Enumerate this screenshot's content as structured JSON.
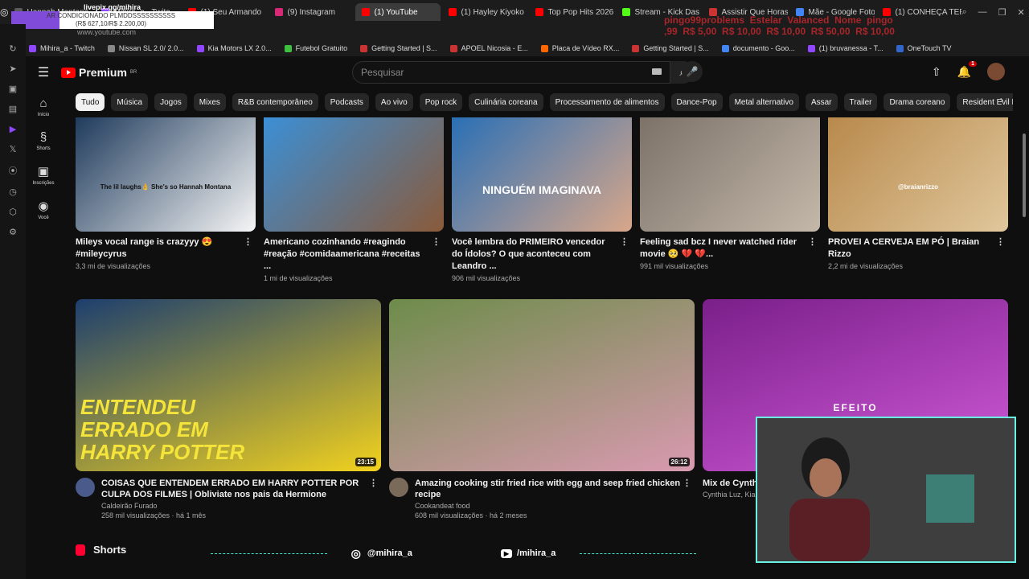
{
  "browser": {
    "tabs": [
      {
        "label": "Hannah Montana",
        "color": "#5a5a5a"
      },
      {
        "label": "Mihira_a - Twitc",
        "color": "#9146ff"
      },
      {
        "label": "(1) Seu Armando",
        "color": "#ff0000"
      },
      {
        "label": "(9) Instagram",
        "color": "#d62976"
      },
      {
        "label": "(1) YouTube",
        "color": "#ff0000",
        "active": true
      },
      {
        "label": "(1) Hayley Kiyoko",
        "color": "#ff0000"
      },
      {
        "label": "Top Pop Hits 2026",
        "color": "#ff0000"
      },
      {
        "label": "Stream - Kick Das",
        "color": "#53fc18"
      },
      {
        "label": "Assistir Que Horas",
        "color": "#cc3333"
      },
      {
        "label": "Mãe - Google Foto",
        "color": "#4285f4"
      },
      {
        "label": "(1) CONHEÇA TER",
        "color": "#ff0000"
      }
    ],
    "window_controls": [
      "search-icon",
      "minimize-icon",
      "restore-icon",
      "close-icon"
    ],
    "address": "www.youtube.com",
    "overlay": {
      "title": "livepix.gg/mihira",
      "line1": "AR CONDICIONADO PLMDDSSSSSSSSSS",
      "line2": "(R$ 627,10/R$ 2.200,00)"
    },
    "prices": "pingo99problems  Estelar  Valanced  Nome  pingo\n,99  R$ 5,00  R$ 10,00  R$ 10,00  R$ 50,00  R$ 10,00",
    "bookmarks": [
      {
        "label": "Mihira_a - Twitch",
        "color": "#9146ff"
      },
      {
        "label": "Nissan SL 2.0/ 2.0...",
        "color": "#888"
      },
      {
        "label": "Kia Motors LX 2.0...",
        "color": "#9146ff"
      },
      {
        "label": "Futebol Gratuito",
        "color": "#3fbf3f"
      },
      {
        "label": "Getting Started | S...",
        "color": "#c33"
      },
      {
        "label": "APOEL Nicosia - E...",
        "color": "#c33"
      },
      {
        "label": "Placa de Vídeo RX...",
        "color": "#f60"
      },
      {
        "label": "Getting Started | S...",
        "color": "#c33"
      },
      {
        "label": "documento - Goo...",
        "color": "#4285f4"
      },
      {
        "label": "(1) bruvanessa - T...",
        "color": "#9146ff"
      },
      {
        "label": "OneTouch TV",
        "color": "#3366cc"
      }
    ]
  },
  "youtube": {
    "logo": "Premium",
    "region": "BR",
    "search_placeholder": "Pesquisar",
    "notifications": "1",
    "guide": [
      {
        "label": "Início",
        "icon": "home-icon"
      },
      {
        "label": "Shorts",
        "icon": "shorts-icon"
      },
      {
        "label": "Inscrições",
        "icon": "subscriptions-icon"
      },
      {
        "label": "Você",
        "icon": "profile-icon"
      }
    ],
    "chips": [
      "Tudo",
      "Música",
      "Jogos",
      "Mixes",
      "R&B contemporâneo",
      "Podcasts",
      "Ao vivo",
      "Pop rock",
      "Culinária coreana",
      "Processamento de alimentos",
      "Dance-Pop",
      "Metal alternativo",
      "Assar",
      "Trailer",
      "Drama coreano",
      "Resident Evil F"
    ],
    "row1": [
      {
        "title": "Mileys vocal range is crazyyy 😍 #mileycyrus",
        "views": "3,3 mi de visualizações",
        "colors": [
          "#1f3b5c",
          "#f6f6f6"
        ],
        "caption": "The lil laughs👌 She's so Hannah Montana"
      },
      {
        "title": "Americano cozinhando #reagindo #reação #comidaamericana #receitas ...",
        "views": "1 mi de visualizações",
        "colors": [
          "#3b8fd6",
          "#8a5a3a"
        ]
      },
      {
        "title": "Você lembra do PRIMEIRO vencedor do Ídolos? O que aconteceu com Leandro ...",
        "views": "906 mil visualizações",
        "colors": [
          "#2a6fb5",
          "#d9a78a"
        ],
        "caption": "NINGUÉM IMAGINAVA"
      },
      {
        "title": "Feeling sad bcz I never watched rider movie 🥺 💔 💔...",
        "views": "991 mil visualizações",
        "colors": [
          "#7c7268",
          "#c4b8aa"
        ]
      },
      {
        "title": "PROVEI A CERVEJA EM PÓ | Braian Rizzo",
        "views": "2,2 mi de visualizações",
        "colors": [
          "#b8894c",
          "#e0c79c"
        ],
        "caption": "@braianrizzo"
      }
    ],
    "row2": [
      {
        "title": "COISAS QUE ENTENDEM ERRADO EM HARRY POTTER POR CULPA DOS FILMES | Obliviate nos pais da Hermione",
        "channel": "Caldeirão Furado",
        "meta": "258 mil visualizações · há 1 mês",
        "duration": "23:15",
        "colors": [
          "#1d3f6e",
          "#f2d21e"
        ],
        "caption": "ENTENDEU ERRADO EM HARRY POTTER",
        "avatar": "#4a5a8a"
      },
      {
        "title": "Amazing cooking stir fried rice with egg and seep fried chicken recipe",
        "channel": "Cookandeat food",
        "meta": "608 mil visualizações · há 2 meses",
        "duration": "26:12",
        "colors": [
          "#6d8c4a",
          "#d99ab0"
        ],
        "avatar": "#7a6a5a"
      },
      {
        "title": "Mix de Cynthi",
        "channel": "Cynthia Luz, Kia",
        "meta": "",
        "colors": [
          "#7a1f8a",
          "#d05ad8"
        ],
        "caption": "EFEITO",
        "avatar": ""
      }
    ],
    "shorts_label": "Shorts",
    "social": {
      "instagram": "@mihira_a",
      "youtube": "/mihira_a"
    }
  },
  "colors": {
    "bg": "#0f0f0f",
    "accent": "#ff0000",
    "webcam_border": "#6bf0e4"
  }
}
